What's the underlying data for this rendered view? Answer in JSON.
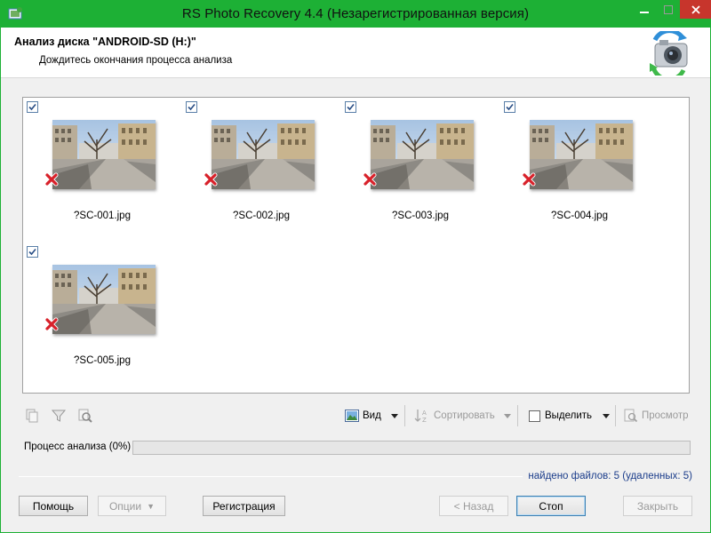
{
  "window": {
    "title": "RS Photo Recovery 4.4 (Незарегистрированная версия)",
    "accent": "#1db035",
    "close_color": "#c7352c"
  },
  "header": {
    "title": "Анализ диска \"ANDROID-SD (H:)\"",
    "subtitle": "Дождитесь окончания процесса анализа"
  },
  "files": [
    {
      "name": "?SC-001.jpg",
      "checked": true,
      "deleted": true
    },
    {
      "name": "?SC-002.jpg",
      "checked": true,
      "deleted": true
    },
    {
      "name": "?SC-003.jpg",
      "checked": true,
      "deleted": true
    },
    {
      "name": "?SC-004.jpg",
      "checked": true,
      "deleted": true
    },
    {
      "name": "?SC-005.jpg",
      "checked": true,
      "deleted": true
    }
  ],
  "toolbar": {
    "view_label": "Вид",
    "sort_label": "Сортировать",
    "select_label": "Выделить",
    "preview_label": "Просмотр"
  },
  "progress": {
    "label": "Процесс анализа (0%)",
    "value": 0
  },
  "status": {
    "found": "найдено файлов: 5 (удаленных: 5)"
  },
  "buttons": {
    "help": "Помощь",
    "options": "Опции",
    "register": "Регистрация",
    "back": "< Назад",
    "stop": "Стоп",
    "close": "Закрыть"
  }
}
